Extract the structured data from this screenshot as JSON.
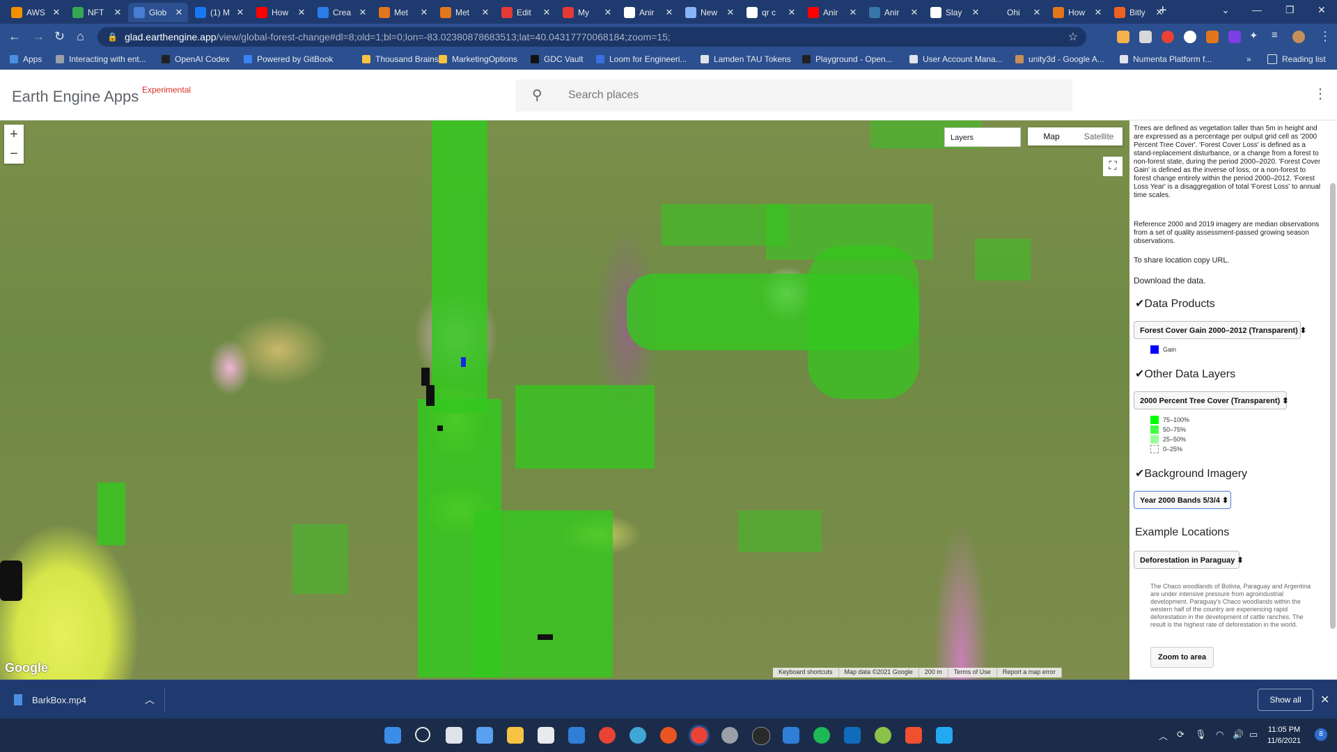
{
  "browser": {
    "tabs": [
      {
        "label": "AWS",
        "color": "#f29100"
      },
      {
        "label": "NFT",
        "color": "#34a853"
      },
      {
        "label": "Glob",
        "color": "#4a7cd3",
        "active": true
      },
      {
        "label": "(1) M",
        "color": "#1877f2"
      },
      {
        "label": "How",
        "color": "#ff0000"
      },
      {
        "label": "Crea",
        "color": "#2b7de9"
      },
      {
        "label": "Met",
        "color": "#e2761b"
      },
      {
        "label": "Met",
        "color": "#e2761b"
      },
      {
        "label": "Edit",
        "color": "#e53935"
      },
      {
        "label": "My",
        "color": "#e53935"
      },
      {
        "label": "Anir",
        "color": "#ffffff"
      },
      {
        "label": "New",
        "color": "#8ab4f8"
      },
      {
        "label": "qr c",
        "color": "#ffffff"
      },
      {
        "label": "Anir",
        "color": "#ff0000"
      },
      {
        "label": "Anir",
        "color": "#3776ab"
      },
      {
        "label": "Slay",
        "color": "#ffffff"
      },
      {
        "label": "Ohi",
        "color": "#1e3a6e"
      },
      {
        "label": "How",
        "color": "#e2761b"
      },
      {
        "label": "Bitly",
        "color": "#ee6123"
      }
    ],
    "url_host": "glad.earthengine.app",
    "url_path": "/view/global-forest-change#dl=8;old=1;bl=0;lon=-83.02380878683513;lat=40.04317770068184;zoom=15;",
    "bookmarks": [
      "Apps",
      "Interacting with ent...",
      "OpenAI Codex",
      "Powered by GitBook",
      "Thousand Brains",
      "MarketingOptions",
      "GDC Vault",
      "Loom for Engineeri...",
      "Lamden TAU Tokens",
      "Playground - Open...",
      "User Account Mana...",
      "unity3d - Google A...",
      "Numenta Platform f..."
    ],
    "bookmarks_more": "»",
    "reading_list": "Reading list"
  },
  "app": {
    "name": "Earth Engine Apps",
    "badge": "Experimental",
    "search_placeholder": "Search places"
  },
  "map": {
    "layers_label": "Layers",
    "map_label": "Map",
    "satellite_label": "Satellite",
    "zoom_in": "+",
    "zoom_out": "−",
    "google_logo": "Google",
    "attribution": [
      "Keyboard shortcuts",
      "Map data ©2021 Google",
      "200 m",
      "Terms of Use",
      "Report a map error"
    ]
  },
  "panel": {
    "intro": "Trees are defined as vegetation taller than 5m in height and are expressed as a percentage per output grid cell as '2000 Percent Tree Cover'. 'Forest Cover Loss' is defined as a stand-replacement disturbance, or a change from a forest to non-forest state, during the period 2000–2020. 'Forest Cover Gain' is defined as the inverse of loss, or a non-forest to forest change entirely within the period 2000–2012. 'Forest Loss Year' is a disaggregation of total 'Forest Loss' to annual time scales.",
    "reference": "Reference 2000 and 2019 imagery are median observations from a set of quality assessment-passed growing season observations.",
    "share": "To share location copy URL.",
    "download": "Download the data.",
    "data_products_title": "Data Products",
    "data_products_select": "Forest Cover Gain 2000–2012 (Transparent)",
    "gain_label": "Gain",
    "gain_color": "#0000ff",
    "other_layers_title": "Other Data Layers",
    "other_layers_select": "2000 Percent Tree Cover (Transparent)",
    "tree_cover_legend": [
      {
        "label": "75–100%",
        "color": "#00ff00"
      },
      {
        "label": "50–75%",
        "color": "#44ff44"
      },
      {
        "label": "25–50%",
        "color": "#99ff99"
      },
      {
        "label": "0–25%",
        "color": "#ffffff"
      }
    ],
    "background_title": "Background Imagery",
    "background_select": "Year 2000 Bands 5/3/4",
    "examples_title": "Example Locations",
    "examples_select": "Deforestation in Paraguay",
    "example_desc": "The Chaco woodlands of Bolivia, Paraguay and Argentina are under intensive pressure from agroindustrial development. Paraguay's Chaco woodlands within the western half of the country are experiencing rapid deforestation in the development of cattle ranches. The result is the highest rate of deforestation in the world.",
    "zoom_button": "Zoom to area"
  },
  "downloads": {
    "file": "BarkBox.mp4",
    "show_all": "Show all"
  },
  "taskbar": {
    "time": "11:05 PM",
    "date": "11/6/2021",
    "notifications": "8"
  }
}
